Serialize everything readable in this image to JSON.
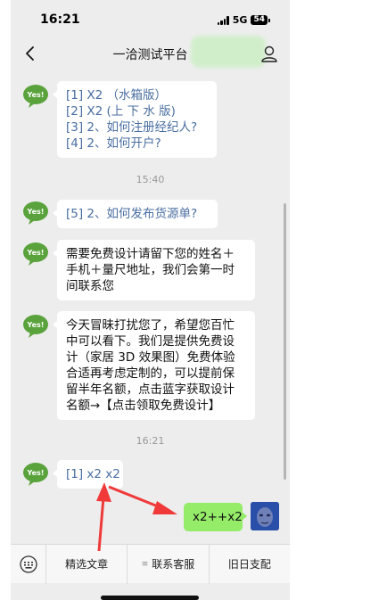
{
  "status_bar": {
    "time": "16:21",
    "network": "5G",
    "battery": "54"
  },
  "nav": {
    "title": "一洽测试平台"
  },
  "bot": {
    "avatar_label": "Yes!"
  },
  "messages": {
    "m1": {
      "lines": [
        "[1] X2 （水箱版）",
        "[2] X2 (上 下 水 版)",
        "[3] 2、如何注册经纪人?",
        "[4] 2、如何开户?"
      ]
    },
    "time1": "15:40",
    "m2": {
      "lines": [
        "[5] 2、如何发布货源单?"
      ]
    },
    "m3": {
      "lines": [
        "需要免费设计请留下您的姓名＋",
        "手机＋量尺地址，我们会第一时",
        "间联系您"
      ]
    },
    "m4": {
      "lines": [
        "今天冒昧打扰您了，希望您百忙",
        "中可以看下。我们是提供免费设",
        "计（家居 3D 效果图）免费体验",
        "合适再考虑定制的，可以提前保",
        "留半年名额，点击蓝字获取设计",
        "名额→【点击领取免费设计】"
      ]
    },
    "time2": "16:21",
    "m5": {
      "text": "[1] x2  x2"
    },
    "m6": {
      "text": "x2++x2"
    }
  },
  "bottom_menu": {
    "items": [
      {
        "label": "精选文章",
        "has_menu_icon": false
      },
      {
        "label": "联系客服",
        "has_menu_icon": true
      },
      {
        "label": "旧日支配",
        "has_menu_icon": false
      }
    ]
  },
  "colors": {
    "background": "#ededed",
    "menu_link": "#4a6ea1",
    "my_bubble": "#95ec69",
    "bot_avatar": "#5aa33c",
    "annotation_arrow": "#f03a3a"
  }
}
